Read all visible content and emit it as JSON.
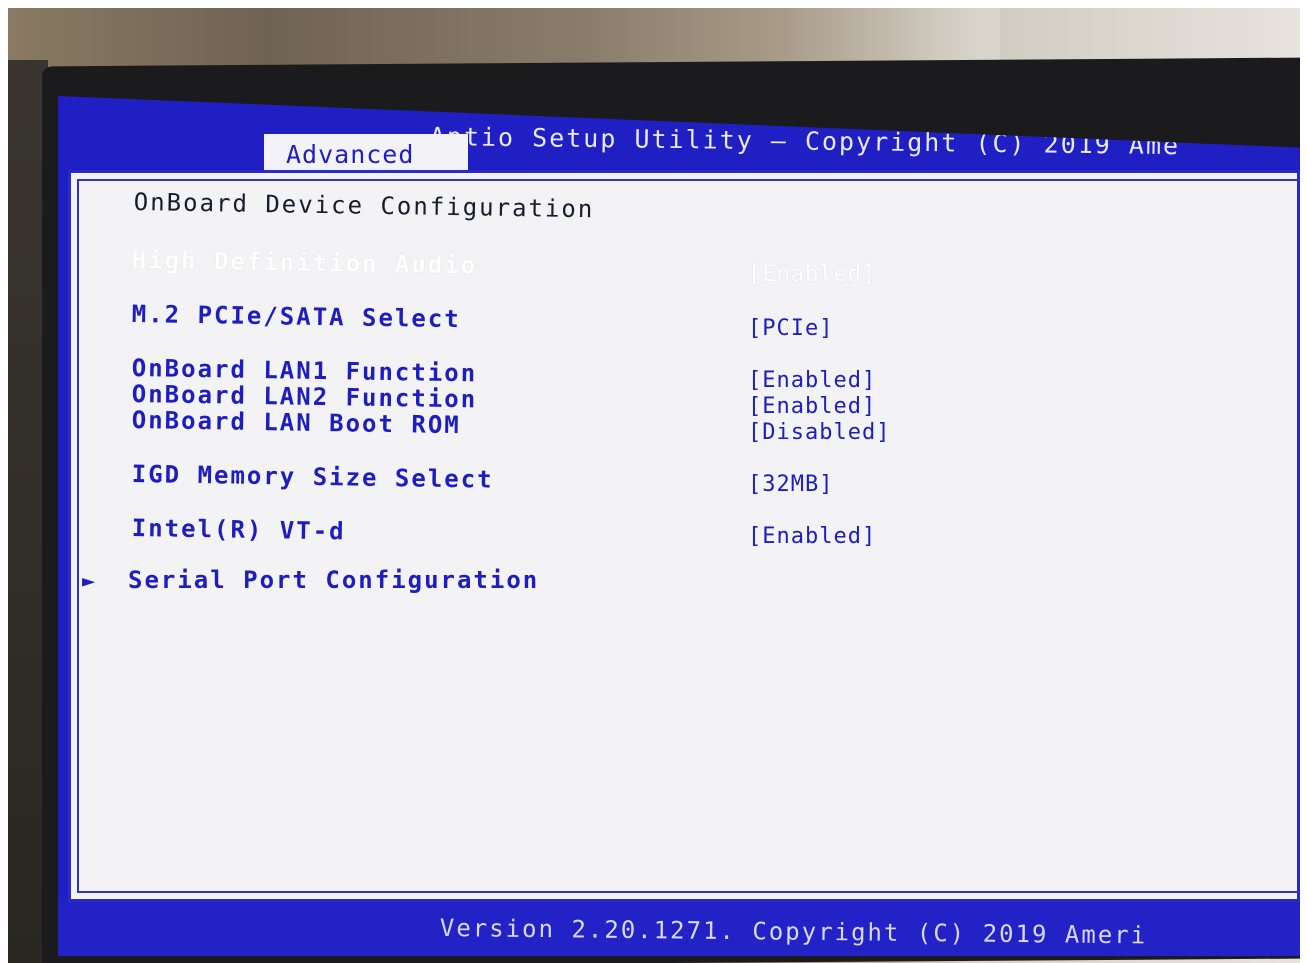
{
  "header": {
    "title": "Aptio Setup Utility – Copyright (C) 2019 Ame",
    "active_tab": "Advanced"
  },
  "page": {
    "section_title": "OnBoard Device Configuration"
  },
  "settings": [
    {
      "label": "High Definition Audio",
      "value": "[Enabled]",
      "selected": true
    },
    {
      "label": "M.2 PCIe/SATA Select",
      "value": "[PCIe]",
      "selected": false
    },
    {
      "label": "OnBoard LAN1 Function",
      "value": "[Enabled]",
      "selected": false
    },
    {
      "label": "OnBoard LAN2 Function",
      "value": "[Enabled]",
      "selected": false
    },
    {
      "label": "OnBoard LAN Boot ROM",
      "value": "[Disabled]",
      "selected": false
    },
    {
      "label": "IGD Memory Size Select",
      "value": "[32MB]",
      "selected": false
    },
    {
      "label": "Intel(R) VT-d",
      "value": "[Enabled]",
      "selected": false
    }
  ],
  "submenu": {
    "arrow_icon": "triangle-right-icon",
    "arrow_glyph": "►",
    "label": "Serial Port Configuration"
  },
  "footer": {
    "text": "Version 2.20.1271. Copyright (C) 2019 Ameri"
  },
  "colors": {
    "bios_blue": "#1f1fc4",
    "panel_background": "#f3f3f6",
    "selected_text": "#ffffff"
  }
}
